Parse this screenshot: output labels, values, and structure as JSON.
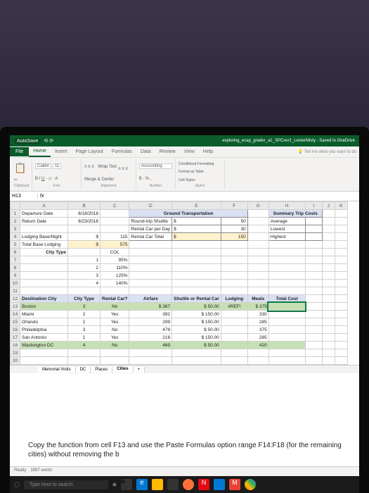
{
  "titlebar": {
    "autosave": "AutoSave",
    "filename": "exploring_ecap_grader_a1_SPCver1_LesterMisty - Saved to OneDrive"
  },
  "tabs": {
    "file": "File",
    "home": "Home",
    "insert": "Insert",
    "pagelayout": "Page Layout",
    "formulas": "Formulas",
    "data": "Data",
    "review": "Review",
    "view": "View",
    "help": "Help",
    "tell": "Tell me what you want to do"
  },
  "ribbon": {
    "clipboard": "Clipboard",
    "font_name": "Calibri",
    "font_size": "11",
    "font": "Font",
    "alignment": "Alignment",
    "wrap": "Wrap Text",
    "merge": "Merge & Center",
    "number": "Number",
    "pct": "$ · % ,",
    "cond": "Conditional Formatting",
    "fmtas": "Format as Table",
    "cellst": "Cell Styles",
    "styles": "Styles",
    "accounting": "Accounting"
  },
  "namebox": {
    "cell": "H13",
    "fx": "fx"
  },
  "cols": {
    "A": "A",
    "B": "B",
    "C": "C",
    "D": "D",
    "E": "E",
    "F": "F",
    "G": "G",
    "H": "H",
    "I": "I",
    "J": "J",
    "K": "K"
  },
  "rows": {
    "r1": {
      "A": "Departure Date",
      "B": "8/18/2018",
      "D": "Ground Transportation",
      "H": "Summary Trip Costs"
    },
    "r2": {
      "A": "Return Date",
      "B": "8/23/2018",
      "D": "Round-trip Shuttle",
      "E": "$",
      "F": "50",
      "H": "Average"
    },
    "r3": {
      "D": "Rental Car per Day",
      "E": "$",
      "F": "30",
      "H": "Lowest"
    },
    "r4": {
      "A": "Lodging Base/Night",
      "B": "$",
      "C": "115",
      "D": "Rental Car Total",
      "E": "$",
      "F": "150",
      "H": "Highest"
    },
    "r5": {
      "A": "Total Base Lodging",
      "B": "$",
      "C": "575"
    },
    "r6": {
      "A": "City Type",
      "C": "COL"
    },
    "r7": {
      "B": "1",
      "C": "95%"
    },
    "r8": {
      "B": "2",
      "C": "110%"
    },
    "r9": {
      "B": "3",
      "C": "125%"
    },
    "r10": {
      "B": "4",
      "C": "140%"
    },
    "r12": {
      "A": "Destination City",
      "B": "City Type",
      "C": "Rental Car?",
      "D": "Airfare",
      "E": "Shuttle or Rental Car",
      "F": "Lodging",
      "G": "Meals",
      "H": "Total Cost"
    },
    "r13": {
      "A": "Boston",
      "B": "3",
      "C": "No",
      "D": "$         367",
      "E": "$    50.00",
      "F": "#REF!",
      "G": "$       375"
    },
    "r14": {
      "A": "Miami",
      "B": "2",
      "C": "Yes",
      "D": "392",
      "E": "$  150.00",
      "G": "330"
    },
    "r15": {
      "A": "Orlando",
      "B": "1",
      "C": "Yes",
      "D": "299",
      "E": "$  150.00",
      "G": "285"
    },
    "r16": {
      "A": "Philadelphia",
      "B": "3",
      "C": "No",
      "D": "479",
      "E": "$    50.00",
      "G": "375"
    },
    "r17": {
      "A": "San Antonio",
      "B": "1",
      "C": "Yes",
      "D": "218",
      "E": "$  150.00",
      "G": "285"
    },
    "r18": {
      "A": "Washington DC",
      "B": "4",
      "C": "No",
      "D": "469",
      "E": "$    50.00",
      "G": "420"
    }
  },
  "sheets": {
    "s1": "Memorial Visits",
    "s2": "DC",
    "s3": "Places",
    "s4": "Cities",
    "plus": "+"
  },
  "status": {
    "ready": "Ready",
    "words": "1697 words"
  },
  "instruction": "Copy the function from cell F13 and use the Paste Formulas option range F14:F18 (for the remaining cities) without removing the b",
  "taskbar": {
    "search": "Type here to search"
  }
}
